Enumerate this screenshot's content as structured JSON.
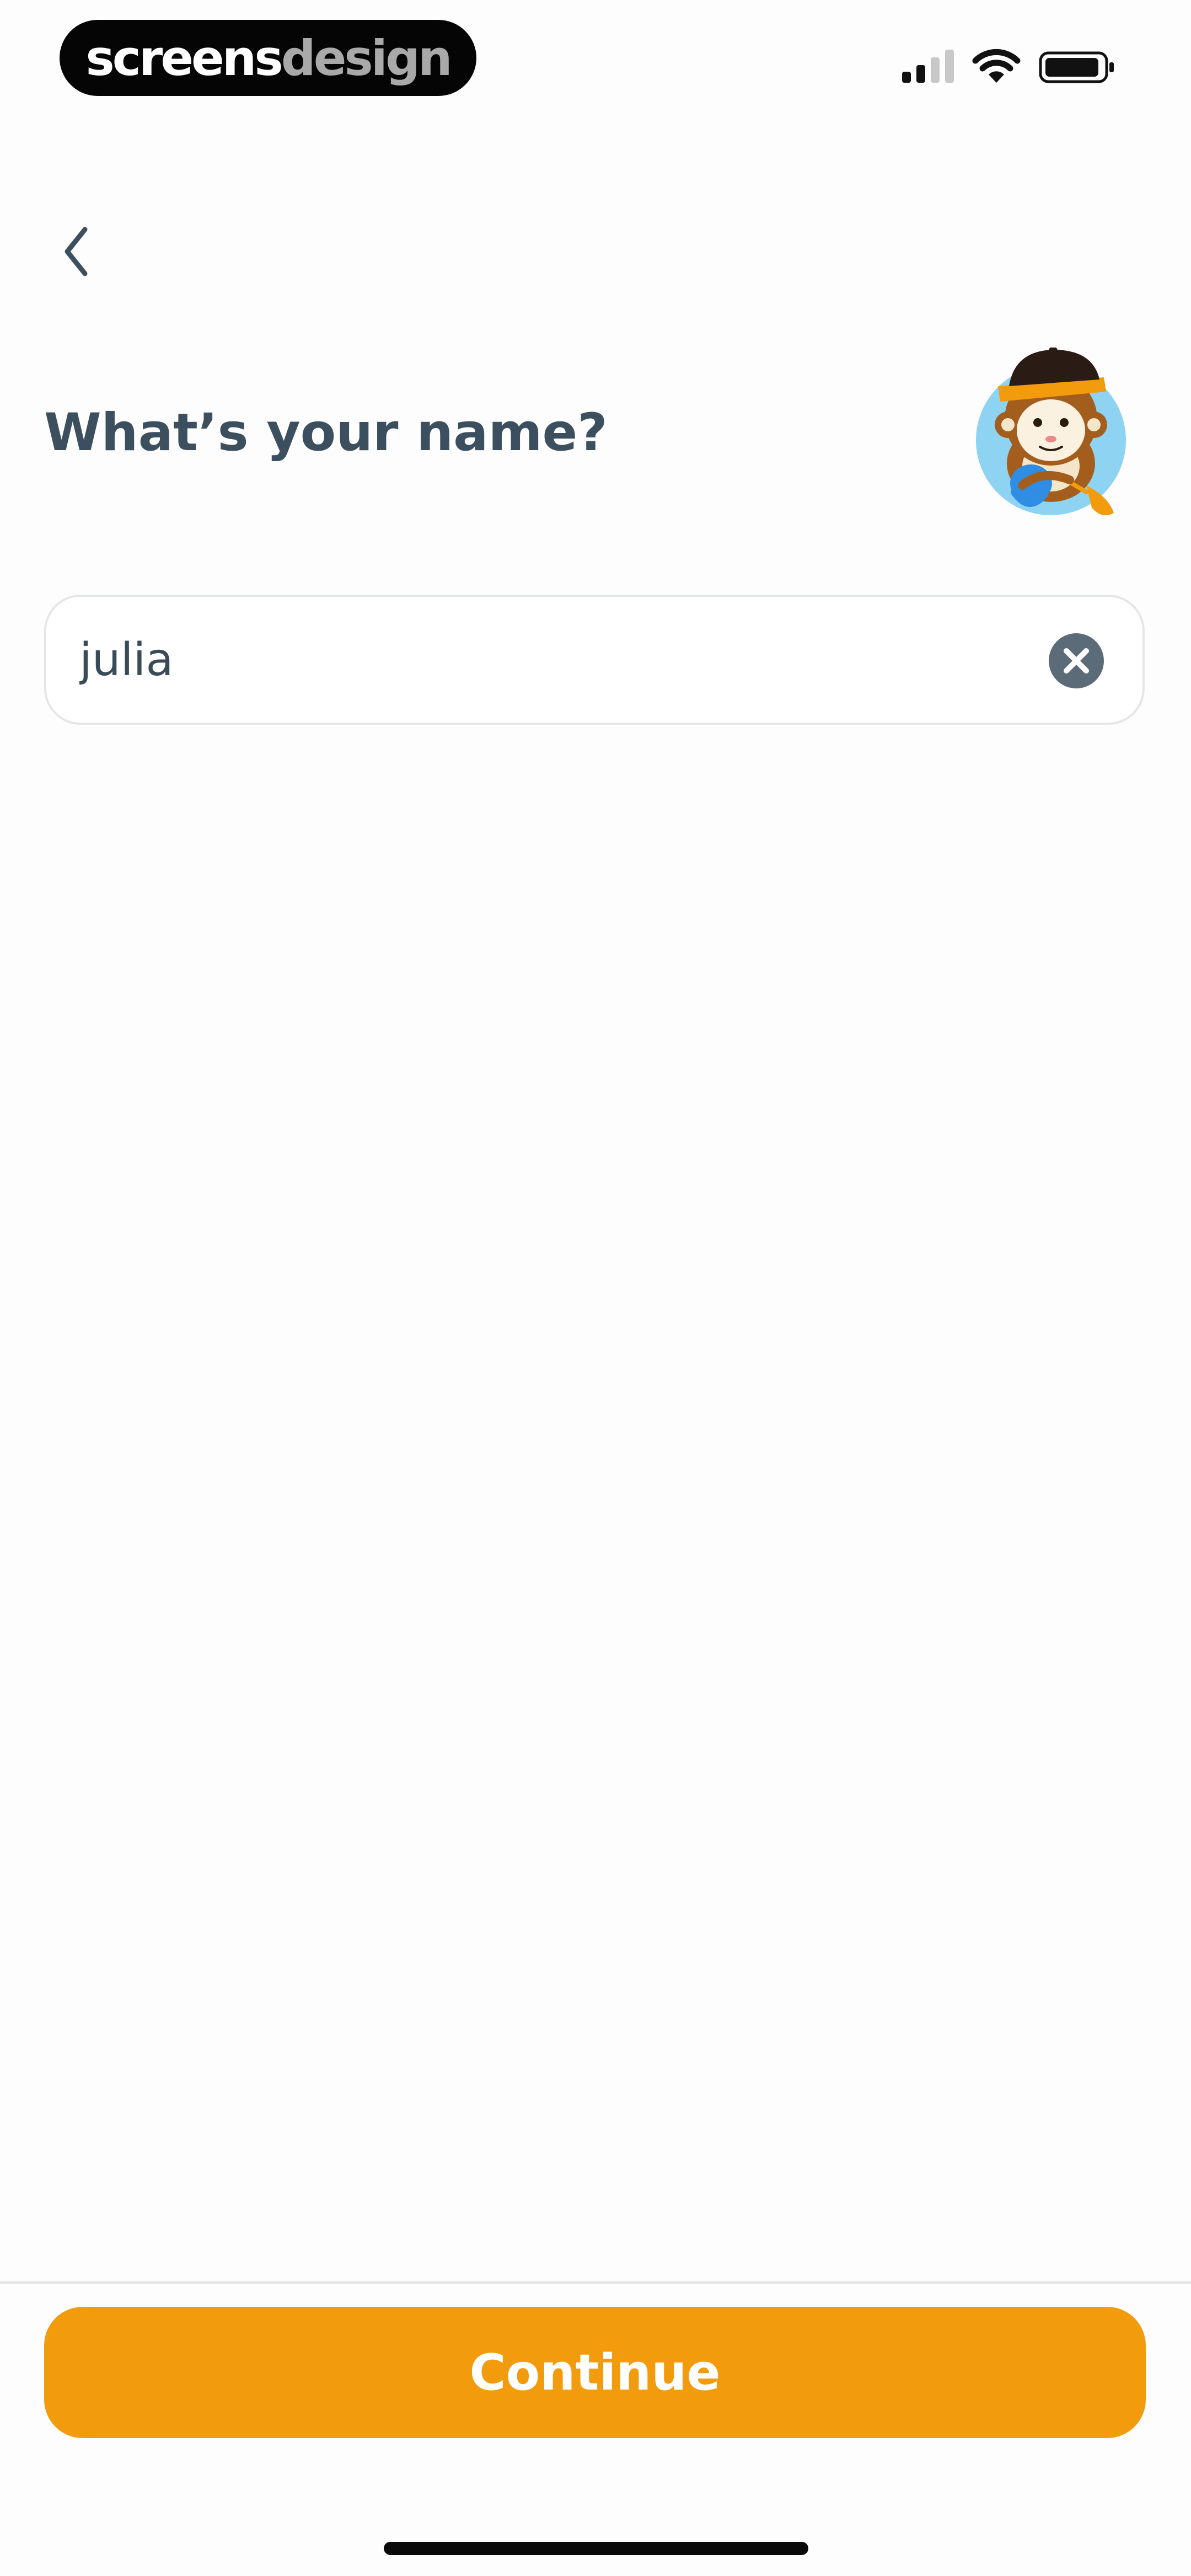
{
  "status_bar": {
    "brand_part1": "screens",
    "brand_part2": "design",
    "icons": [
      "signal-icon",
      "wifi-icon",
      "battery-icon"
    ]
  },
  "nav": {
    "back_icon": "chevron-left-icon"
  },
  "prompt": {
    "title": "What’s your name?",
    "mascot_icon": "monkey-mascot-icon"
  },
  "name_input": {
    "value": "julia",
    "clear_icon": "clear-circle-x-icon"
  },
  "footer": {
    "continue_label": "Continue"
  },
  "colors": {
    "accent": "#f29b0c",
    "title_text": "#3c4f5e",
    "clear_icon": "#5b6b78",
    "mascot_circle": "#8fd3f3"
  }
}
